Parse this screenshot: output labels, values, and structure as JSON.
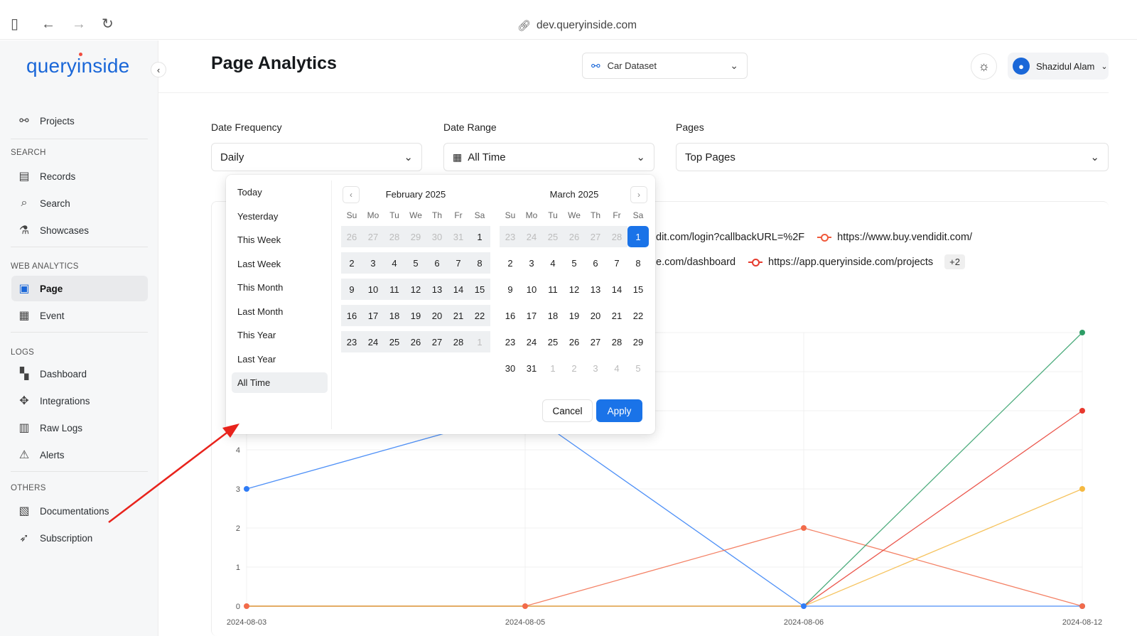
{
  "browser": {
    "url": "dev.queryinside.com"
  },
  "app": {
    "logo": "queryinside"
  },
  "sidebar": {
    "projects": "Projects",
    "sections": [
      {
        "label": "SEARCH",
        "items": [
          "Records",
          "Search",
          "Showcases"
        ]
      },
      {
        "label": "WEB ANALYTICS",
        "items": [
          "Page",
          "Event"
        ]
      },
      {
        "label": "LOGS",
        "items": [
          "Dashboard",
          "Integrations",
          "Raw Logs",
          "Alerts"
        ]
      },
      {
        "label": "OTHERS",
        "items": [
          "Documentations",
          "Subscription"
        ]
      }
    ],
    "active": "Page"
  },
  "header": {
    "title": "Page Analytics",
    "dataset": "Car Dataset",
    "user": "Shazidul Alam"
  },
  "filters": {
    "frequency_label": "Date Frequency",
    "frequency_value": "Daily",
    "range_label": "Date Range",
    "range_value": "All Time",
    "pages_label": "Pages",
    "pages_value": "Top Pages"
  },
  "legend": {
    "item1": "dit.com/login?callbackURL=%2F",
    "item2": "https://www.buy.vendidit.com/",
    "item3": "e.com/dashboard",
    "item4": "https://app.queryinside.com/projects",
    "more": "+2"
  },
  "datepicker": {
    "presets": [
      "Today",
      "Yesterday",
      "This Week",
      "Last Week",
      "This Month",
      "Last Month",
      "This Year",
      "Last Year",
      "All Time"
    ],
    "selected_preset": "All Time",
    "weekdays": [
      "Su",
      "Mo",
      "Tu",
      "We",
      "Th",
      "Fr",
      "Sa"
    ],
    "months": [
      {
        "title": "February 2025",
        "days": [
          {
            "d": "26",
            "muted": true,
            "range": true
          },
          {
            "d": "27",
            "muted": true,
            "range": true
          },
          {
            "d": "28",
            "muted": true,
            "range": true
          },
          {
            "d": "29",
            "muted": true,
            "range": true
          },
          {
            "d": "30",
            "muted": true,
            "range": true
          },
          {
            "d": "31",
            "muted": true,
            "range": true
          },
          {
            "d": "1",
            "range": true
          },
          {
            "d": "2",
            "range": true
          },
          {
            "d": "3",
            "range": true
          },
          {
            "d": "4",
            "range": true
          },
          {
            "d": "5",
            "range": true
          },
          {
            "d": "6",
            "range": true
          },
          {
            "d": "7",
            "range": true
          },
          {
            "d": "8",
            "range": true
          },
          {
            "d": "9",
            "range": true
          },
          {
            "d": "10",
            "range": true
          },
          {
            "d": "11",
            "range": true
          },
          {
            "d": "12",
            "range": true
          },
          {
            "d": "13",
            "range": true
          },
          {
            "d": "14",
            "range": true
          },
          {
            "d": "15",
            "range": true
          },
          {
            "d": "16",
            "range": true
          },
          {
            "d": "17",
            "range": true
          },
          {
            "d": "18",
            "range": true
          },
          {
            "d": "19",
            "range": true
          },
          {
            "d": "20",
            "range": true
          },
          {
            "d": "21",
            "range": true
          },
          {
            "d": "22",
            "range": true
          },
          {
            "d": "23",
            "range": true
          },
          {
            "d": "24",
            "range": true
          },
          {
            "d": "25",
            "range": true
          },
          {
            "d": "26",
            "range": true
          },
          {
            "d": "27",
            "range": true
          },
          {
            "d": "28",
            "range": true
          },
          {
            "d": "1",
            "muted": true,
            "range": true
          }
        ]
      },
      {
        "title": "March 2025",
        "days": [
          {
            "d": "23",
            "muted": true,
            "range": true
          },
          {
            "d": "24",
            "muted": true,
            "range": true
          },
          {
            "d": "25",
            "muted": true,
            "range": true
          },
          {
            "d": "26",
            "muted": true,
            "range": true
          },
          {
            "d": "27",
            "muted": true,
            "range": true
          },
          {
            "d": "28",
            "muted": true,
            "range": true
          },
          {
            "d": "1",
            "sel": true
          },
          {
            "d": "2"
          },
          {
            "d": "3"
          },
          {
            "d": "4"
          },
          {
            "d": "5"
          },
          {
            "d": "6"
          },
          {
            "d": "7"
          },
          {
            "d": "8"
          },
          {
            "d": "9"
          },
          {
            "d": "10"
          },
          {
            "d": "11"
          },
          {
            "d": "12"
          },
          {
            "d": "13"
          },
          {
            "d": "14"
          },
          {
            "d": "15"
          },
          {
            "d": "16"
          },
          {
            "d": "17"
          },
          {
            "d": "18"
          },
          {
            "d": "19"
          },
          {
            "d": "20"
          },
          {
            "d": "21"
          },
          {
            "d": "22"
          },
          {
            "d": "23"
          },
          {
            "d": "24"
          },
          {
            "d": "25"
          },
          {
            "d": "26"
          },
          {
            "d": "27"
          },
          {
            "d": "28"
          },
          {
            "d": "29"
          },
          {
            "d": "30"
          },
          {
            "d": "31"
          },
          {
            "d": "1",
            "muted": true
          },
          {
            "d": "2",
            "muted": true
          },
          {
            "d": "3",
            "muted": true
          },
          {
            "d": "4",
            "muted": true
          },
          {
            "d": "5",
            "muted": true
          }
        ]
      }
    ],
    "cancel": "Cancel",
    "apply": "Apply"
  },
  "colors": {
    "accent": "#1a73e8",
    "brand": "#1a67d8"
  },
  "chart_data": {
    "type": "line",
    "x": [
      "2024-08-03",
      "2024-08-05",
      "2024-08-06",
      "2024-08-12"
    ],
    "y_ticks_visible": [
      "0",
      "1",
      "2",
      "3",
      "4"
    ],
    "ylim": [
      0,
      7
    ],
    "series": [
      {
        "color": "#2f7cf6",
        "values": [
          3,
          5,
          0,
          0
        ]
      },
      {
        "color": "#f26b4a",
        "values": [
          0,
          0,
          2,
          0
        ]
      },
      {
        "color": "#2e9d66",
        "values": [
          0,
          0,
          0,
          7
        ]
      },
      {
        "color": "#e8392e",
        "values": [
          0,
          0,
          0,
          5
        ]
      },
      {
        "color": "#f5b942",
        "values": [
          0,
          0,
          0,
          3
        ]
      }
    ]
  }
}
